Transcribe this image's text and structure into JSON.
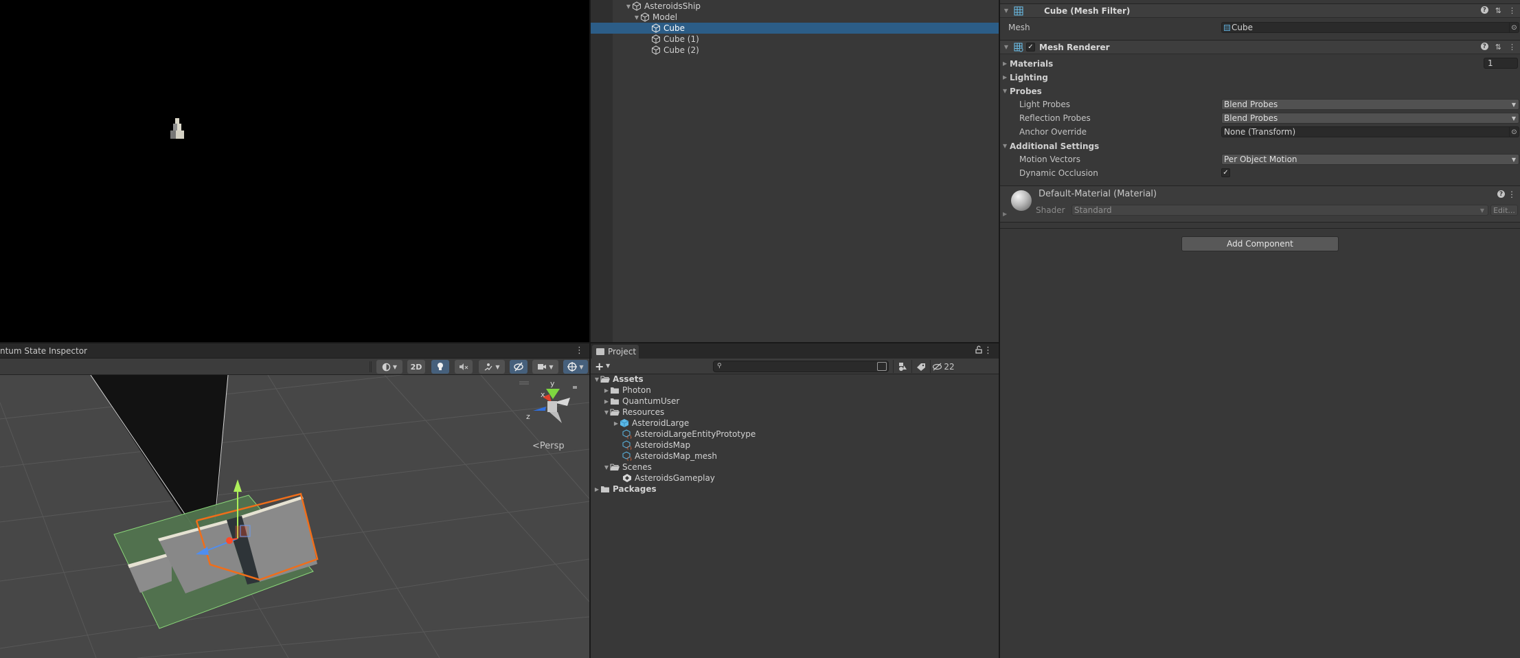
{
  "game_view": {},
  "scene_view": {
    "tab_label": "ntum State Inspector",
    "toolbar": {
      "shading_mode": "shaded-sphere-icon",
      "btn_2d_label": "2D",
      "lighting": "lightbulb-icon",
      "audio": "audio-mute-icon",
      "effects": "effects-icon",
      "hidden": "visibility-icon",
      "camera": "camera-icon",
      "gizmos": "gizmo-icon"
    },
    "gizmo_axes": {
      "x": "x",
      "y": "y",
      "z": "z"
    },
    "projection_label": "Persp",
    "projection_arrow": "<"
  },
  "hierarchy": {
    "items": [
      {
        "label": "AsteroidsShip",
        "expanded": true
      },
      {
        "label": "Model",
        "expanded": true
      },
      {
        "label": "Cube",
        "selected": true
      },
      {
        "label": "Cube (1)"
      },
      {
        "label": "Cube (2)"
      }
    ]
  },
  "project": {
    "tab_label": "Project",
    "add_label": "+",
    "search": {
      "value": "",
      "placeholder": ""
    },
    "hidden_count": "22",
    "tree": [
      {
        "label": "Assets",
        "depth": 0,
        "expanded": true,
        "bold": true,
        "icon": "folder-open-icon"
      },
      {
        "label": "Photon",
        "depth": 1,
        "expanded": false,
        "icon": "folder-icon"
      },
      {
        "label": "QuantumUser",
        "depth": 1,
        "expanded": false,
        "icon": "folder-icon"
      },
      {
        "label": "Resources",
        "depth": 1,
        "expanded": true,
        "icon": "folder-open-icon"
      },
      {
        "label": "AsteroidLarge",
        "depth": 2,
        "expanded": false,
        "icon": "prefab-icon"
      },
      {
        "label": "AsteroidLargeEntityPrototype",
        "depth": 2,
        "icon": "quantum-asset-icon"
      },
      {
        "label": "AsteroidsMap",
        "depth": 2,
        "icon": "quantum-asset-icon"
      },
      {
        "label": "AsteroidsMap_mesh",
        "depth": 2,
        "icon": "quantum-asset-icon"
      },
      {
        "label": "Scenes",
        "depth": 1,
        "expanded": true,
        "icon": "folder-open-icon"
      },
      {
        "label": "AsteroidsGameplay",
        "depth": 2,
        "icon": "unity-scene-icon"
      },
      {
        "label": "Packages",
        "depth": 0,
        "expanded": false,
        "bold": true,
        "icon": "folder-icon"
      }
    ]
  },
  "inspector": {
    "mesh_filter": {
      "title": "Cube (Mesh Filter)",
      "mesh_label": "Mesh",
      "mesh_value": "Cube"
    },
    "mesh_renderer": {
      "title": "Mesh Renderer",
      "enabled": true,
      "materials_label": "Materials",
      "materials_count": "1",
      "lighting_label": "Lighting",
      "probes_label": "Probes",
      "light_probes_label": "Light Probes",
      "light_probes_value": "Blend Probes",
      "reflection_probes_label": "Reflection Probes",
      "reflection_probes_value": "Blend Probes",
      "anchor_override_label": "Anchor Override",
      "anchor_override_value": "None (Transform)",
      "additional_settings_label": "Additional Settings",
      "motion_vectors_label": "Motion Vectors",
      "motion_vectors_value": "Per Object Motion",
      "dynamic_occlusion_label": "Dynamic Occlusion",
      "dynamic_occlusion": true
    },
    "material": {
      "title": "Default-Material (Material)",
      "shader_label": "Shader",
      "shader_value": "Standard",
      "edit_label": "Edit..."
    },
    "add_component_label": "Add Component"
  },
  "glyphs": {
    "check": "✓",
    "menu": "⋮",
    "help": "?",
    "presets": "⇅",
    "target": "⊙",
    "caret": "▼",
    "fold_open": "▼",
    "fold_closed": "▶",
    "lock": "🔓"
  },
  "colors": {
    "selection": "#2c5d87",
    "accent_on": "#46607c",
    "panel_bg": "#383838",
    "quantum_orange": "#e0663a",
    "prefab_blue": "#5bb8e6"
  }
}
